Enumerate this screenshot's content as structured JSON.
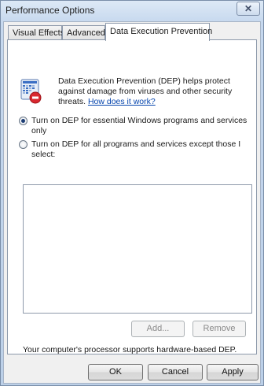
{
  "window": {
    "title": "Performance Options",
    "close_glyph": "✕"
  },
  "tabs": [
    {
      "label": "Visual Effects",
      "active": false
    },
    {
      "label": "Advanced",
      "active": false
    },
    {
      "label": "Data Execution Prevention",
      "active": true
    }
  ],
  "dep": {
    "icon": "dep-shield-icon",
    "description": "Data Execution Prevention (DEP) helps protect against damage from viruses and other security threats.",
    "link_text": "How does it work?",
    "options": [
      {
        "label": "Turn on DEP for essential Windows programs and services only",
        "selected": true
      },
      {
        "label": "Turn on DEP for all programs and services except those I select:",
        "selected": false
      }
    ],
    "exceptions_list": [],
    "add_label": "Add...",
    "remove_label": "Remove",
    "support_text": "Your computer's processor supports hardware-based DEP."
  },
  "footer": {
    "ok_label": "OK",
    "cancel_label": "Cancel",
    "apply_label": "Apply"
  },
  "colors": {
    "link": "#0645ad",
    "title_bar": "#c6d8ee",
    "icon_red": "#d9272e",
    "icon_blue": "#3b6fc4"
  }
}
